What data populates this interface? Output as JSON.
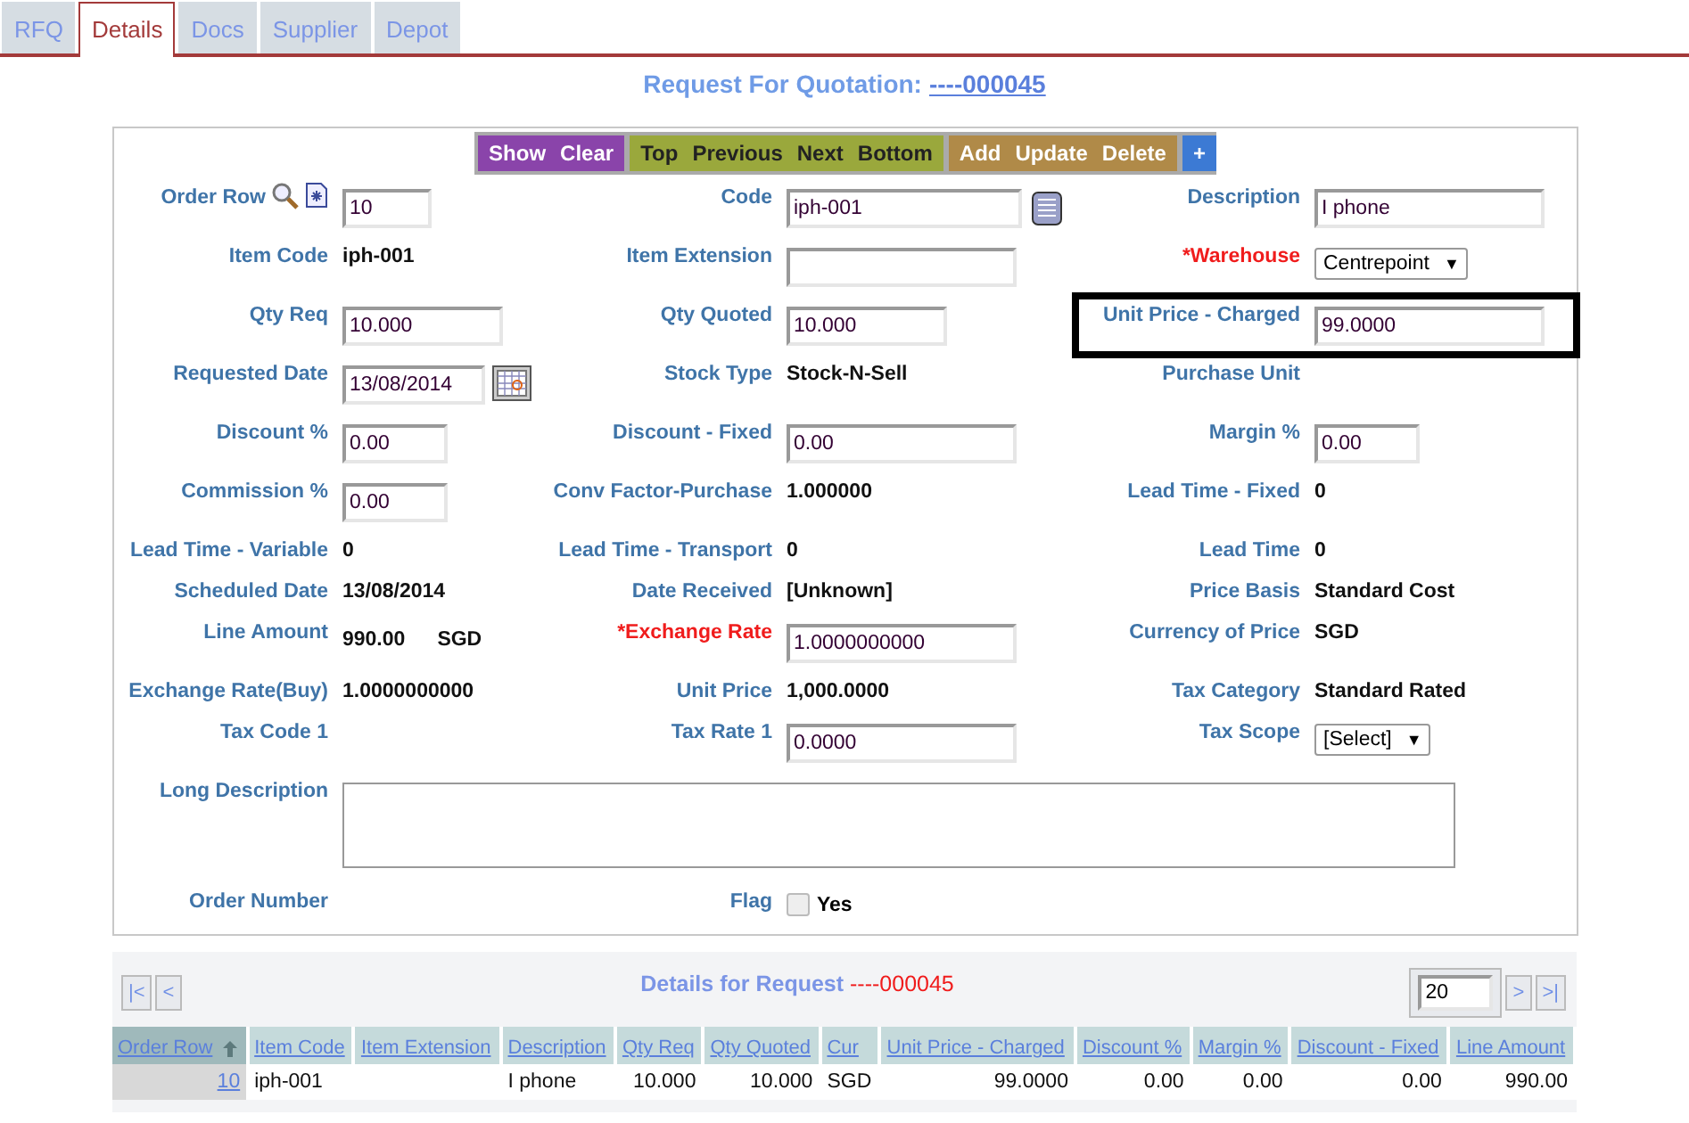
{
  "tabs": [
    {
      "label": "RFQ",
      "selected": false
    },
    {
      "label": "Details",
      "selected": true
    },
    {
      "label": "Docs",
      "selected": false
    },
    {
      "label": "Supplier",
      "selected": false
    },
    {
      "label": "Depot",
      "selected": false
    }
  ],
  "title": {
    "text": "Request For Quotation:",
    "number": "----000045"
  },
  "toolbar": [
    {
      "kind": "view",
      "buttons": [
        "Show",
        "Clear"
      ]
    },
    {
      "kind": "nav",
      "buttons": [
        "Top",
        "Previous",
        "Next",
        "Bottom"
      ]
    },
    {
      "kind": "edit",
      "buttons": [
        "Add",
        "Update",
        "Delete"
      ]
    },
    {
      "kind": "more",
      "buttons": [
        "+"
      ]
    }
  ],
  "form": {
    "rows": [
      {
        "cells": [
          {
            "label": "Order Row",
            "kind": "order",
            "value": "10"
          },
          {
            "label": "Code",
            "kind": "lookup",
            "value": "iph-001"
          },
          {
            "label": "Description",
            "kind": "input",
            "value": "I phone"
          }
        ]
      },
      {
        "cells": [
          {
            "label": "Item Code",
            "kind": "text",
            "value": "iph-001"
          },
          {
            "label": "Item Extension",
            "kind": "input"
          },
          {
            "label": "*Warehouse",
            "kind": "select",
            "value": "Centrepoint",
            "arrow": "▼",
            "required": true
          }
        ]
      },
      {
        "cells": [
          {
            "label": "Qty Req",
            "kind": "input",
            "value": "10.000"
          },
          {
            "label": "Qty Quoted",
            "kind": "input",
            "value": "10.000"
          },
          {
            "label": "Unit Price - Charged",
            "kind": "input",
            "value": "99.0000",
            "highlighted": true
          }
        ]
      },
      {
        "cells": [
          {
            "label": "Requested Date",
            "kind": "date",
            "value": "13/08/2014"
          },
          {
            "label": "Stock Type",
            "kind": "text",
            "value": "Stock-N-Sell"
          },
          {
            "label": "Purchase Unit",
            "kind": "none"
          }
        ]
      },
      {
        "cells": [
          {
            "label": "Discount %",
            "kind": "input",
            "value": "0.00"
          },
          {
            "label": "Discount - Fixed",
            "kind": "input",
            "value": "0.00"
          },
          {
            "label": "Margin %",
            "kind": "input",
            "value": "0.00"
          }
        ]
      },
      {
        "cells": [
          {
            "label": "Commission %",
            "kind": "input",
            "value": "0.00"
          },
          {
            "label": "Conv Factor-Purchase",
            "kind": "text",
            "value": "1.000000"
          },
          {
            "label": "Lead Time - Fixed",
            "kind": "text",
            "value": "0"
          }
        ]
      },
      {
        "cells": [
          {
            "label": "Lead Time - Variable",
            "kind": "text",
            "value": "0"
          },
          {
            "label": "Lead Time - Transport",
            "kind": "text",
            "value": "0"
          },
          {
            "label": "Lead Time",
            "kind": "text",
            "value": "0"
          }
        ]
      },
      {
        "cells": [
          {
            "label": "Scheduled Date",
            "kind": "text",
            "value": "13/08/2014"
          },
          {
            "label": "Date Received",
            "kind": "text",
            "value": "[Unknown]"
          },
          {
            "label": "Price Basis",
            "kind": "text",
            "value": "Standard Cost"
          }
        ]
      },
      {
        "cells": [
          {
            "label": "Line Amount",
            "kind": "amount",
            "value": "990.00",
            "currency": "SGD"
          },
          {
            "label": "*Exchange Rate",
            "kind": "input",
            "value": "1.0000000000",
            "required": true
          },
          {
            "label": "Currency of Price",
            "kind": "text",
            "value": "SGD"
          }
        ]
      },
      {
        "cells": [
          {
            "label": "Exchange Rate(Buy)",
            "kind": "text",
            "value": "1.0000000000"
          },
          {
            "label": "Unit Price",
            "kind": "text",
            "value": "1,000.0000"
          },
          {
            "label": "Tax Category",
            "kind": "text",
            "value": "Standard Rated"
          }
        ]
      },
      {
        "cells": [
          {
            "label": "Tax Code 1",
            "kind": "none"
          },
          {
            "label": "Tax Rate 1",
            "kind": "input",
            "value": "0.0000"
          },
          {
            "label": "Tax Scope",
            "kind": "select",
            "value": "[Select]",
            "arrow": "▼"
          }
        ]
      },
      {
        "cells": [
          {
            "label": "Long Description",
            "kind": "textarea"
          }
        ]
      },
      {
        "cells": [
          {
            "label": "Order Number",
            "kind": "none"
          },
          {
            "label": "Flag",
            "kind": "checkbox",
            "checked": false,
            "text": "Yes"
          }
        ]
      }
    ]
  },
  "details": {
    "title": "Details for Request",
    "number": "----000045",
    "pager_first": "|<",
    "pager_prev": "<",
    "page_size": "20",
    "pager_next": ">",
    "pager_last": ">|",
    "columns": [
      "Order Row",
      "Item Code",
      "Item Extension",
      "Description",
      "Qty Req",
      "Qty Quoted",
      "Cur",
      "Unit Price - Charged",
      "Discount %",
      "Margin %",
      "Discount - Fixed",
      "Line Amount"
    ],
    "rows": [
      [
        "10",
        "iph-001",
        "",
        "I phone",
        "10.000",
        "10.000",
        "SGD",
        "99.0000",
        "0.00",
        "0.00",
        "0.00",
        "990.00"
      ]
    ]
  }
}
